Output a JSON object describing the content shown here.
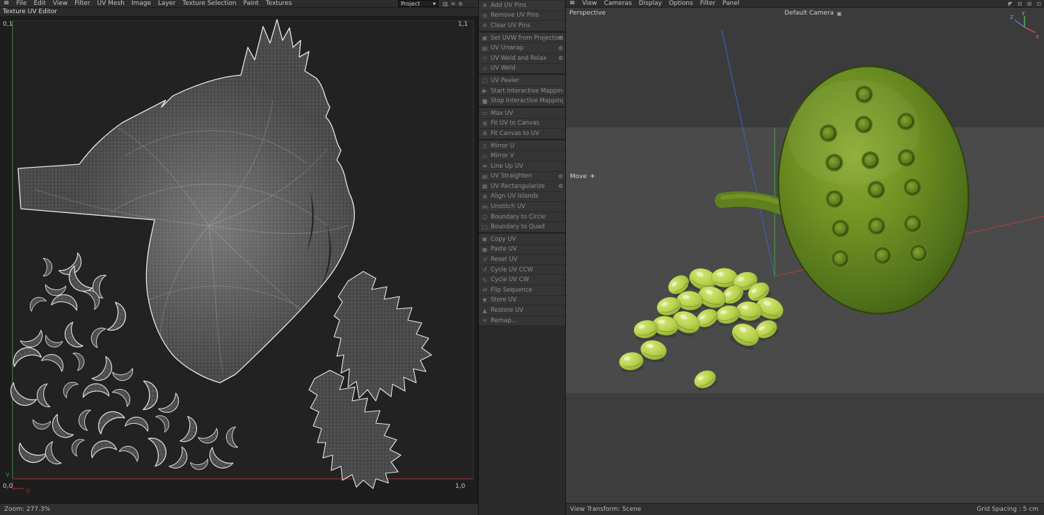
{
  "uv_editor": {
    "menubar": {
      "hamburger": "≡",
      "items": [
        "File",
        "Edit",
        "View",
        "Filter",
        "UV Mesh",
        "Image",
        "Layer",
        "Texture Selection",
        "Paint",
        "Textures"
      ],
      "project_dropdown": {
        "label": "Project",
        "caret": "▾"
      },
      "toolbar_icons": [
        {
          "name": "histogram-icon",
          "glyph": "▥"
        },
        {
          "name": "layer-stack-icon",
          "glyph": "≋"
        },
        {
          "name": "pan-hand-icon",
          "glyph": "⊛"
        }
      ]
    },
    "panel_title": "Texture UV Editor",
    "corner_labels": {
      "top_left": "0,1",
      "top_right": "1,1",
      "bottom_left": "0,0",
      "bottom_right": "1,0"
    },
    "axes": {
      "u_label": "U",
      "v_label": "V"
    },
    "status": "Zoom: 277.3%"
  },
  "uv_commands": {
    "gear_glyph": "⚙",
    "groups": [
      {
        "items": [
          {
            "label": "Add UV Pins",
            "icon": "⊕"
          },
          {
            "label": "Remove UV Pins",
            "icon": "⊖"
          },
          {
            "label": "Clear UV Pins",
            "icon": "⊘"
          }
        ]
      },
      {
        "items": [
          {
            "label": "Set UVW from Projection",
            "icon": "▣",
            "gear": true
          },
          {
            "label": "UV Unwrap",
            "icon": "▤",
            "gear": true
          },
          {
            "label": "UV Weld and Relax",
            "icon": "◇",
            "gear": true
          },
          {
            "label": "UV Weld",
            "icon": "◇"
          }
        ]
      },
      {
        "items": [
          {
            "label": "UV Peeler",
            "icon": "▢"
          },
          {
            "label": "Start Interactive Mapping",
            "icon": "▶"
          },
          {
            "label": "Stop Interactive Mapping",
            "icon": "■"
          }
        ]
      },
      {
        "items": [
          {
            "label": "Max UV",
            "icon": "▭"
          },
          {
            "label": "Fit UV to Canvas",
            "icon": "⊞"
          },
          {
            "label": "Fit Canvas to UV",
            "icon": "⊞"
          }
        ]
      },
      {
        "items": [
          {
            "label": "Mirror U",
            "icon": "▯"
          },
          {
            "label": "Mirror V",
            "icon": "▭"
          },
          {
            "label": "Line Up UV",
            "icon": "≡"
          },
          {
            "label": "UV Straighten",
            "icon": "▤",
            "gear": true
          },
          {
            "label": "UV Rectangularize",
            "icon": "▦",
            "gear": true
          },
          {
            "label": "Align UV Islands",
            "icon": "⊞"
          },
          {
            "label": "Unstitch UV",
            "icon": "⋈"
          },
          {
            "label": "Boundary to Circle",
            "icon": "○"
          },
          {
            "label": "Boundary to Quad",
            "icon": "□"
          }
        ]
      },
      {
        "items": [
          {
            "label": "Copy UV",
            "icon": "▣"
          },
          {
            "label": "Paste UV",
            "icon": "▣"
          },
          {
            "label": "Reset UV",
            "icon": "↺"
          },
          {
            "label": "Cycle UV CCW",
            "icon": "↺"
          },
          {
            "label": "Cycle UV CW",
            "icon": "↻"
          },
          {
            "label": "Flip Sequence",
            "icon": "⇄"
          },
          {
            "label": "Store UV",
            "icon": "▼"
          },
          {
            "label": "Restore UV",
            "icon": "▲"
          },
          {
            "label": "Remap...",
            "icon": "≈"
          }
        ]
      }
    ]
  },
  "viewport": {
    "menubar": {
      "hamburger": "≡",
      "items": [
        "View",
        "Cameras",
        "Display",
        "Options",
        "Filter",
        "Panel"
      ],
      "right_icons": [
        {
          "name": "select-arrow-icon",
          "glyph": "◤"
        },
        {
          "name": "dock-icon",
          "glyph": "⊟"
        },
        {
          "name": "layout-grid-icon",
          "glyph": "⊞"
        },
        {
          "name": "float-window-icon",
          "glyph": "⊡"
        }
      ]
    },
    "labels": {
      "projection": "Perspective",
      "camera": "Default Camera",
      "camera_icon": "▣",
      "tool": "Move",
      "tool_icon": "+"
    },
    "gizmo": {
      "x": "X",
      "y": "Y",
      "z": "Z"
    },
    "status_left": "View Transform: Scene",
    "status_right": "Grid Spacing : 5 cm"
  },
  "colors": {
    "uv_axis_u_red": "#a23838",
    "uv_axis_v_green": "#3f8e43",
    "selection_outline": "#ececec",
    "world_axis_x": "#c04040",
    "world_axis_y": "#3f9f46",
    "world_axis_z": "#3a62c8",
    "pod_green": "#6d8f21",
    "seed_green": "#b5d04a"
  }
}
